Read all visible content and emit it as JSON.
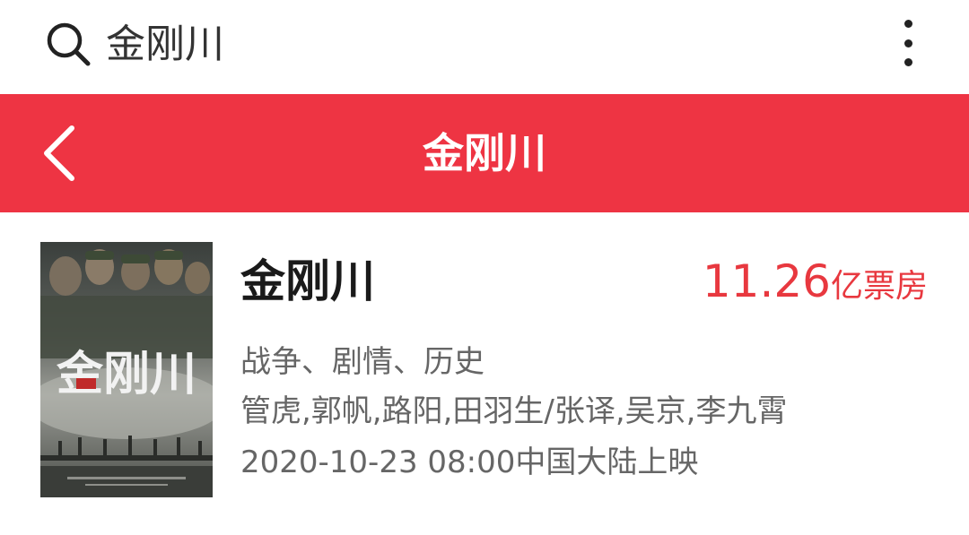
{
  "search": {
    "query": "金刚川"
  },
  "header": {
    "title": "金刚川",
    "background_color": "#ee3443"
  },
  "movie": {
    "title": "金刚川",
    "box_office_value": "11.26",
    "box_office_unit": "亿票房",
    "genres": "战争、剧情、历史",
    "cast": "管虎,郭帆,路阳,田羽生/张译,吴京,李九霄",
    "release": "2020-10-23 08:00中国大陆上映",
    "poster_title_art": "金刚川",
    "accent_color": "#e8383f"
  },
  "icons": {
    "search": "search-icon",
    "more": "more-vertical-icon",
    "back": "chevron-left-icon"
  }
}
